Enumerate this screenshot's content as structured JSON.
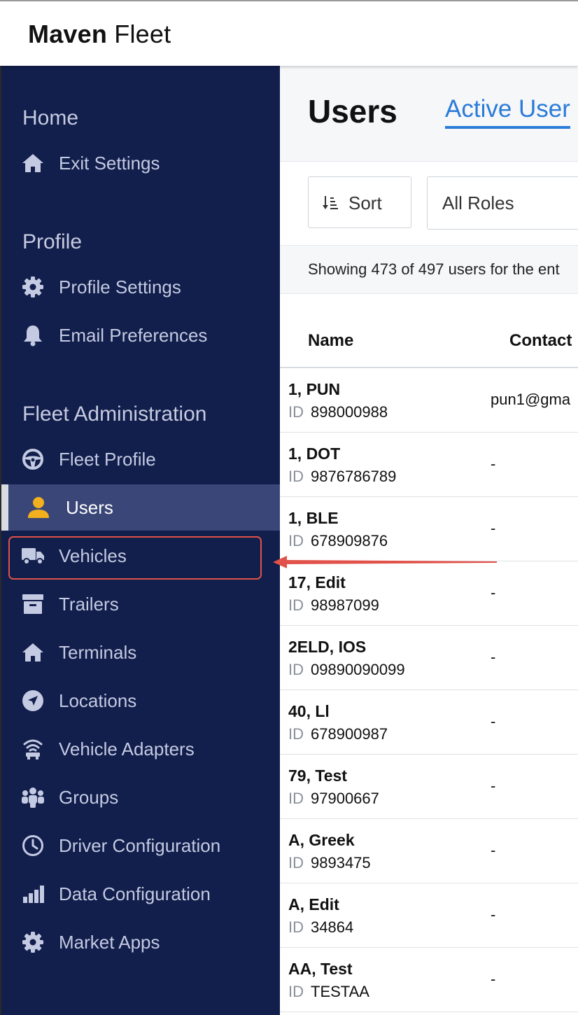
{
  "app": {
    "brand_bold": "Maven",
    "brand_light": " Fleet"
  },
  "sidebar": {
    "sections": {
      "home": "Home",
      "profile": "Profile",
      "fleet_admin": "Fleet Administration"
    },
    "items": {
      "exit_settings": "Exit Settings",
      "profile_settings": "Profile Settings",
      "email_preferences": "Email Preferences",
      "fleet_profile": "Fleet Profile",
      "users": "Users",
      "vehicles": "Vehicles",
      "trailers": "Trailers",
      "terminals": "Terminals",
      "locations": "Locations",
      "vehicle_adapters": "Vehicle Adapters",
      "groups": "Groups",
      "driver_configuration": "Driver Configuration",
      "data_configuration": "Data Configuration",
      "market_apps": "Market Apps"
    },
    "active_item": "users",
    "highlighted_item": "vehicles"
  },
  "main": {
    "title": "Users",
    "tab_active": "Active User",
    "toolbar": {
      "sort_label": "Sort",
      "roles_label": "All Roles"
    },
    "info_text": "Showing 473 of 497 users for the ent",
    "columns": {
      "name": "Name",
      "contact": "Contact"
    },
    "id_label": "ID",
    "rows": [
      {
        "name": "1, PUN",
        "id": "898000988",
        "contact": "pun1@gma"
      },
      {
        "name": "1, DOT",
        "id": "9876786789",
        "contact": "-"
      },
      {
        "name": "1, BLE",
        "id": "678909876",
        "contact": "-"
      },
      {
        "name": "17, Edit",
        "id": "98987099",
        "contact": "-"
      },
      {
        "name": "2ELD, IOS",
        "id": "09890090099",
        "contact": "-"
      },
      {
        "name": "40, Ll",
        "id": "678900987",
        "contact": "-"
      },
      {
        "name": "79, Test",
        "id": "97900667",
        "contact": "-"
      },
      {
        "name": "A, Greek",
        "id": "9893475",
        "contact": "-"
      },
      {
        "name": "A, Edit",
        "id": "34864",
        "contact": "-"
      },
      {
        "name": "AA, Test",
        "id": "TESTAA",
        "contact": "-"
      }
    ]
  },
  "colors": {
    "sidebar_bg": "#121e4b",
    "sidebar_active_bg": "#3a4677",
    "accent_blue": "#2b7bd8",
    "highlight_red": "#e0524a",
    "user_icon_yellow": "#f2b01e"
  }
}
